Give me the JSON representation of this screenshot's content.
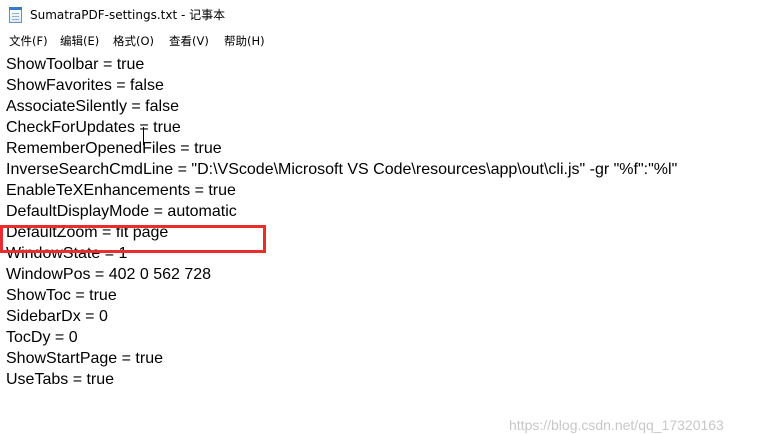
{
  "window": {
    "title": "SumatraPDF-settings.txt - 记事本",
    "icon": "notepad-icon"
  },
  "menu": {
    "items": [
      {
        "label": "文件(F)"
      },
      {
        "label": "编辑(E)"
      },
      {
        "label": "格式(O)"
      },
      {
        "label": "查看(V)"
      },
      {
        "label": "帮助(H)"
      }
    ]
  },
  "editor": {
    "lines": [
      "ShowToolbar = true",
      "ShowFavorites = false",
      "AssociateSilently = false",
      "CheckForUpdates = true",
      "RememberOpenedFiles = true",
      "InverseSearchCmdLine = \"D:\\VScode\\Microsoft VS Code\\resources\\app\\out\\cli.js\" -gr \"%f\":\"%l\"",
      "EnableTeXEnhancements = true",
      "DefaultDisplayMode = automatic",
      "DefaultZoom = fit page",
      "WindowState = 1",
      "WindowPos = 402 0 562 728",
      "ShowToc = true",
      "SidebarDx = 0",
      "TocDy = 0",
      "ShowStartPage = true",
      "UseTabs = true"
    ],
    "highlighted_line": "EnableTeXEnhancements = true",
    "highlight_color": "#ea2c2c"
  },
  "watermark": {
    "text": "https://blog.csdn.net/qq_17320163"
  }
}
